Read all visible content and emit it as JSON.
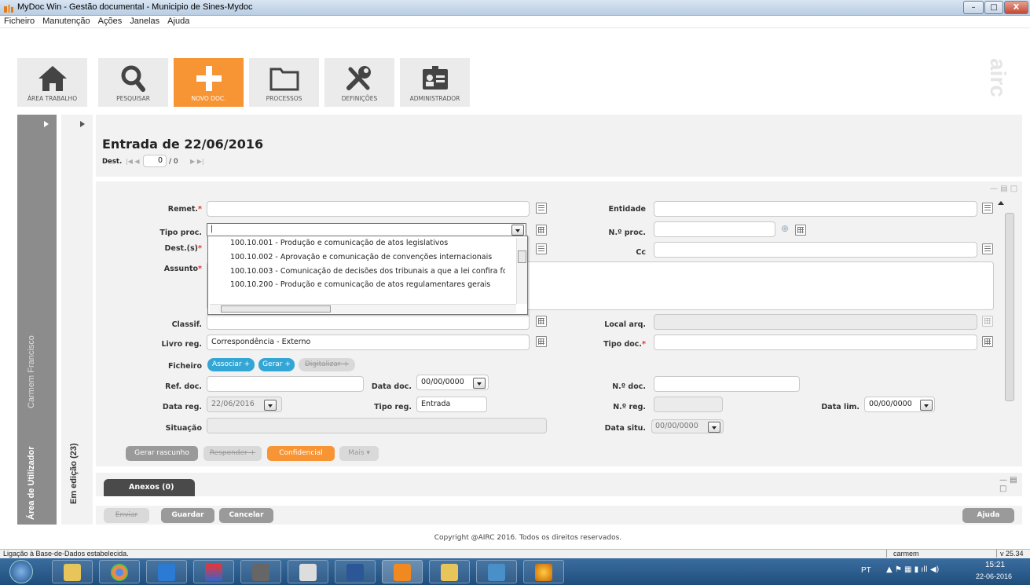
{
  "window": {
    "title": "MyDoc Win - Gestão documental - Municipio de Sines-Mydoc",
    "minimize": "–",
    "maximize": "□",
    "close": "X"
  },
  "menu": [
    "Ficheiro",
    "Manutenção",
    "Ações",
    "Janelas",
    "Ajuda"
  ],
  "nav": [
    {
      "label": "ÁREA TRABALHO",
      "icon": "home-icon"
    },
    {
      "label": "PESQUISAR",
      "icon": "search-icon"
    },
    {
      "label": "NOVO DOC.",
      "icon": "plus-icon",
      "active": true
    },
    {
      "label": "PROCESSOS",
      "icon": "folder-icon"
    },
    {
      "label": "DEFINIÇÕES",
      "icon": "tools-icon"
    },
    {
      "label": "ADMINISTRADOR",
      "icon": "id-card-icon"
    }
  ],
  "brand": "airc",
  "sidebar": {
    "user": "Carmem Francisco",
    "area": "Área de Utilizador",
    "editing": "Em edição (23)"
  },
  "header": {
    "title": "Entrada de 22/06/2016",
    "dest_label": "Dest.",
    "dest_counter": "0",
    "dest_total": "/ 0"
  },
  "form": {
    "remet_label": "Remet.",
    "entidade_label": "Entidade",
    "tipo_proc_label": "Tipo proc.",
    "nproc_label": "N.º proc.",
    "dest_label": "Dest.(s)",
    "cc_label": "Cc",
    "assunto_label": "Assunto",
    "classif_label": "Classif.",
    "local_arq_label": "Local arq.",
    "livro_reg_label": "Livro reg.",
    "livro_reg_value": "Correspondência - Externo",
    "tipo_doc_label": "Tipo doc.",
    "ficheiro_label": "Ficheiro",
    "associar": "Associar +",
    "gerar": "Gerar +",
    "digitalizar": "Digitalizar +",
    "ref_doc_label": "Ref. doc.",
    "data_doc_label": "Data doc.",
    "data_doc_value": "00/00/0000",
    "ndoc_label": "N.º doc.",
    "data_reg_label": "Data reg.",
    "data_reg_value": "22/06/2016",
    "tipo_reg_label": "Tipo reg.",
    "tipo_reg_value": "Entrada",
    "nreg_label": "N.º reg.",
    "data_lim_label": "Data lim.",
    "data_lim_value": "00/00/0000",
    "situacao_label": "Situação",
    "data_situ_label": "Data situ.",
    "data_situ_value": "00/00/0000",
    "required_mark": "*"
  },
  "tipo_proc_options": [
    "100.10.001 - Produção e comunicação de atos legislativos",
    "100.10.002 - Aprovação e comunicação de convenções internacionais",
    "100.10.003 - Comunicação de decisões dos tribunais a que a lei confira fo",
    "100.10.200 - Produção e comunicação de atos regulamentares gerais"
  ],
  "form_actions": {
    "gerar_rascunho": "Gerar rascunho",
    "responder": "Responder +",
    "confidencial": "Confidencial",
    "mais": "Mais ▾"
  },
  "anexos": {
    "tab": "Anexos (0)"
  },
  "bottom_actions": {
    "enviar": "Enviar",
    "guardar": "Guardar",
    "cancelar": "Cancelar",
    "ajuda": "Ajuda"
  },
  "copyright": "Copyright @AIRC 2016. Todos os direitos reservados.",
  "status": {
    "message": "Ligação à Base-de-Dados estabelecida.",
    "user": "carmem",
    "version": "v 25.34"
  },
  "taskbar": {
    "lang": "PT",
    "time": "15:21",
    "date": "22-06-2016"
  },
  "colors": {
    "accent": "#f79433",
    "blue": "#33a6d5",
    "sidebar": "#8c8c8c"
  }
}
